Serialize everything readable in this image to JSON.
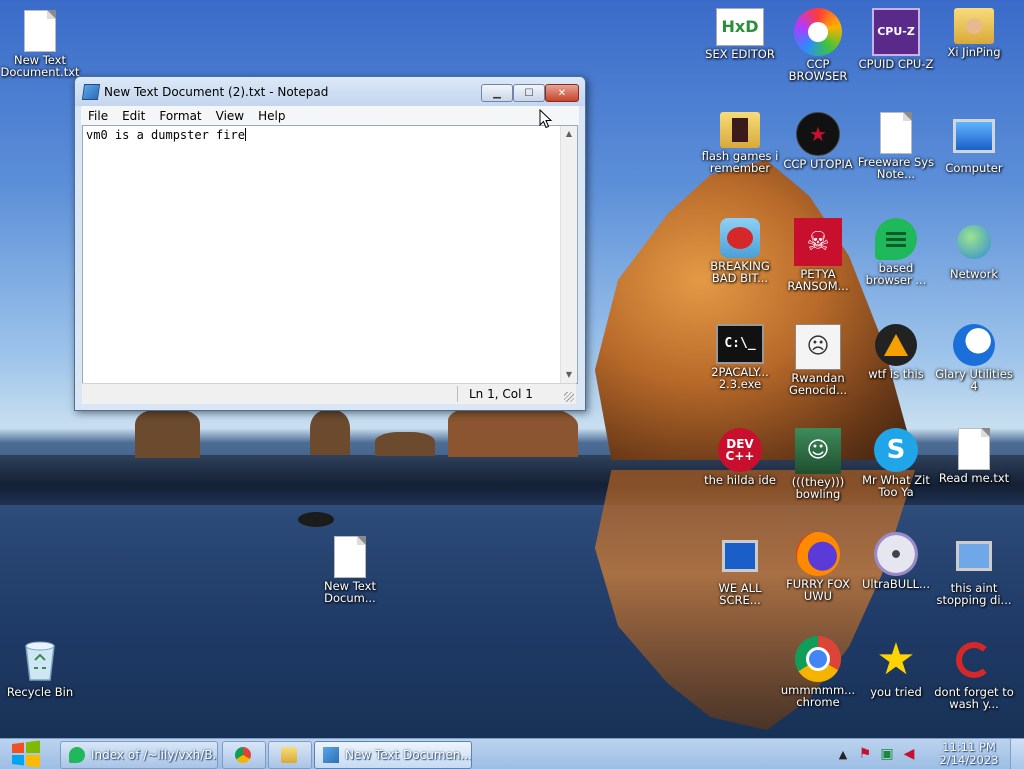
{
  "desktop": {
    "icons": [
      {
        "label": "New Text Document.txt"
      },
      {
        "label": "Recycle Bin"
      },
      {
        "label": "New Text Docum..."
      },
      {
        "label": "SEX EDITOR"
      },
      {
        "label": "CCP BROWSER"
      },
      {
        "label": "CPUID CPU-Z"
      },
      {
        "label": "Xi JinPing"
      },
      {
        "label": "flash games i remember"
      },
      {
        "label": "CCP UTOPIA"
      },
      {
        "label": "Freeware Sys Note..."
      },
      {
        "label": "Computer"
      },
      {
        "label": "BREAKING BAD BIT..."
      },
      {
        "label": "PETYA RANSOM..."
      },
      {
        "label": "based browser ..."
      },
      {
        "label": "Network"
      },
      {
        "label": "2PACALY... 2.3.exe"
      },
      {
        "label": "Rwandan Genocid..."
      },
      {
        "label": "wtf is this"
      },
      {
        "label": "Glary Utilities 4"
      },
      {
        "label": "the hilda ide"
      },
      {
        "label": "(((they))) bowling"
      },
      {
        "label": "Mr What Zit Too Ya"
      },
      {
        "label": "Read me.txt"
      },
      {
        "label": "WE ALL SCRE..."
      },
      {
        "label": "FURRY FOX UWU"
      },
      {
        "label": "UltraBULL..."
      },
      {
        "label": "this aint stopping di..."
      },
      {
        "label": "ummmmm... chrome"
      },
      {
        "label": "you tried"
      },
      {
        "label": "dont forget to wash y..."
      }
    ],
    "icon_glyphs": {
      "hxd": "HxD",
      "cpuz": "CPU-Z",
      "devcpp": "DEV C++",
      "cmd": "C:\\_",
      "ccp_utopia": "★"
    }
  },
  "notepad": {
    "title": "New Text Document (2).txt - Notepad",
    "menu": [
      "File",
      "Edit",
      "Format",
      "View",
      "Help"
    ],
    "content": "vm0 is a dumpster fire",
    "status": "Ln 1, Col 1"
  },
  "taskbar": {
    "buttons": [
      {
        "label": "Index of /~lily/vxh/B..."
      },
      {
        "label": "New Text Documen..."
      }
    ],
    "clock_time": "11:11 PM",
    "clock_date": "2/14/2023"
  }
}
